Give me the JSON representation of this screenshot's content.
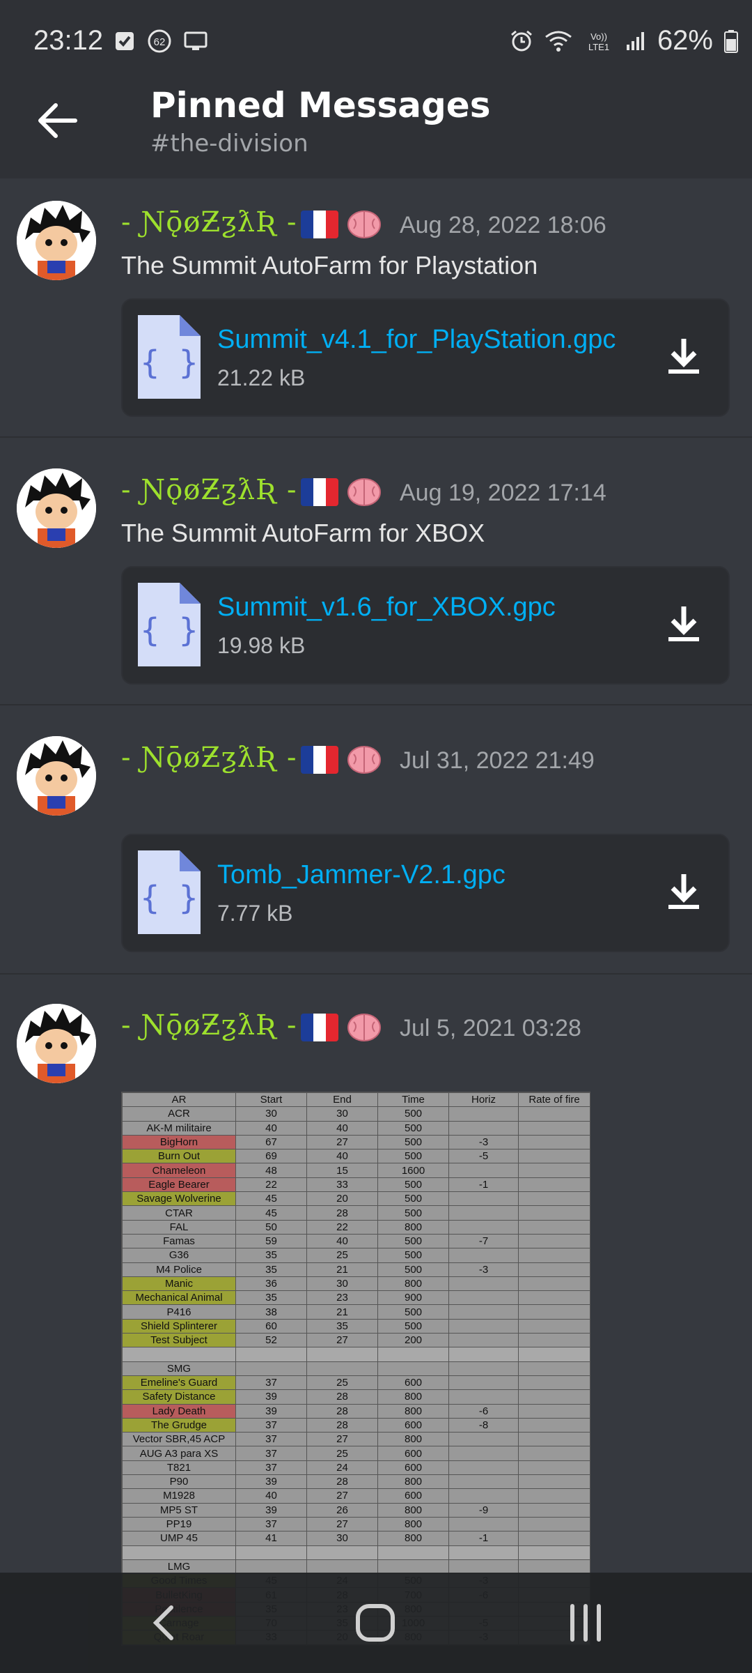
{
  "status_bar": {
    "time": "23:12",
    "battery": "62%",
    "notification_badge": "62",
    "icons": [
      "checkbox-icon",
      "notification-badge-icon",
      "cast-icon",
      "alarm-icon",
      "wifi-icon",
      "volte-icon",
      "signal-icon",
      "battery-icon"
    ]
  },
  "header": {
    "title": "Pinned Messages",
    "channel": "#the-division"
  },
  "messages": [
    {
      "author": "- ƝǭøƵƺƛƦ -",
      "date": "Aug 28, 2022 18:06",
      "text": "The Summit AutoFarm for Playstation",
      "file": {
        "name": "Summit_v4.1_for_PlayStation.gpc",
        "size": "21.22 kB"
      }
    },
    {
      "author": "- ƝǭøƵƺƛƦ -",
      "date": "Aug 19, 2022 17:14",
      "text": "The Summit AutoFarm for XBOX",
      "file": {
        "name": "Summit_v1.6_for_XBOX.gpc",
        "size": "19.98 kB"
      }
    },
    {
      "author": "- ƝǭøƵƺƛƦ -",
      "date": "Jul 31, 2022 21:49",
      "text": "",
      "file": {
        "name": "Tomb_Jammer-V2.1.gpc",
        "size": "7.77 kB"
      }
    },
    {
      "author": "- ƝǭøƵƺƛƦ -",
      "date": "Jul 5, 2021 03:28",
      "text": ""
    }
  ],
  "colors": {
    "background": "#36393f",
    "header": "#2f3136",
    "author": "#9ee12d",
    "link": "#00aff4"
  },
  "sheet": {
    "headers": [
      "AR",
      "Start",
      "End",
      "Time",
      "Horiz",
      "Rate of fire"
    ],
    "rows": [
      {
        "c": [
          "ACR",
          "30",
          "30",
          "500",
          "",
          ""
        ],
        "t": ""
      },
      {
        "c": [
          "AK-M militaire",
          "40",
          "40",
          "500",
          "",
          ""
        ],
        "t": ""
      },
      {
        "c": [
          "BigHorn",
          "67",
          "27",
          "500",
          "-3",
          ""
        ],
        "t": "red"
      },
      {
        "c": [
          "Burn Out",
          "69",
          "40",
          "500",
          "-5",
          ""
        ],
        "t": "ylw"
      },
      {
        "c": [
          "Chameleon",
          "48",
          "15",
          "1600",
          "",
          ""
        ],
        "t": "red"
      },
      {
        "c": [
          "Eagle Bearer",
          "22",
          "33",
          "500",
          "-1",
          ""
        ],
        "t": "red"
      },
      {
        "c": [
          "Savage Wolverine",
          "45",
          "20",
          "500",
          "",
          ""
        ],
        "t": "ylw"
      },
      {
        "c": [
          "CTAR",
          "45",
          "28",
          "500",
          "",
          ""
        ],
        "t": ""
      },
      {
        "c": [
          "FAL",
          "50",
          "22",
          "800",
          "",
          ""
        ],
        "t": ""
      },
      {
        "c": [
          "Famas",
          "59",
          "40",
          "500",
          "-7",
          ""
        ],
        "t": ""
      },
      {
        "c": [
          "G36",
          "35",
          "25",
          "500",
          "",
          ""
        ],
        "t": ""
      },
      {
        "c": [
          "M4 Police",
          "35",
          "21",
          "500",
          "-3",
          ""
        ],
        "t": ""
      },
      {
        "c": [
          "Manic",
          "36",
          "30",
          "800",
          "",
          ""
        ],
        "t": "ylw"
      },
      {
        "c": [
          "Mechanical Animal",
          "35",
          "23",
          "900",
          "",
          ""
        ],
        "t": "ylw"
      },
      {
        "c": [
          "P416",
          "38",
          "21",
          "500",
          "",
          ""
        ],
        "t": ""
      },
      {
        "c": [
          "Shield Splinterer",
          "60",
          "35",
          "500",
          "",
          ""
        ],
        "t": "ylw"
      },
      {
        "c": [
          "Test Subject",
          "52",
          "27",
          "200",
          "",
          ""
        ],
        "t": "ylw"
      },
      {
        "c": [
          "",
          "",
          "",
          "",
          "",
          ""
        ],
        "t": "sep"
      },
      {
        "c": [
          "SMG",
          "",
          "",
          "",
          "",
          ""
        ],
        "t": ""
      },
      {
        "c": [
          "Emeline's Guard",
          "37",
          "25",
          "600",
          "",
          ""
        ],
        "t": "ylw"
      },
      {
        "c": [
          "Safety Distance",
          "39",
          "28",
          "800",
          "",
          ""
        ],
        "t": "ylw"
      },
      {
        "c": [
          "Lady Death",
          "39",
          "28",
          "800",
          "-6",
          ""
        ],
        "t": "red"
      },
      {
        "c": [
          "The Grudge",
          "37",
          "28",
          "600",
          "-8",
          ""
        ],
        "t": "ylw"
      },
      {
        "c": [
          "Vector SBR,45 ACP",
          "37",
          "27",
          "800",
          "",
          ""
        ],
        "t": ""
      },
      {
        "c": [
          "AUG A3 para XS",
          "37",
          "25",
          "600",
          "",
          ""
        ],
        "t": ""
      },
      {
        "c": [
          "T821",
          "37",
          "24",
          "600",
          "",
          ""
        ],
        "t": ""
      },
      {
        "c": [
          "P90",
          "39",
          "28",
          "800",
          "",
          ""
        ],
        "t": ""
      },
      {
        "c": [
          "M1928",
          "40",
          "27",
          "600",
          "",
          ""
        ],
        "t": ""
      },
      {
        "c": [
          "MP5 ST",
          "39",
          "26",
          "800",
          "-9",
          ""
        ],
        "t": ""
      },
      {
        "c": [
          "PP19",
          "37",
          "27",
          "800",
          "",
          ""
        ],
        "t": ""
      },
      {
        "c": [
          "UMP 45",
          "41",
          "30",
          "800",
          "-1",
          ""
        ],
        "t": ""
      },
      {
        "c": [
          "",
          "",
          "",
          "",
          "",
          ""
        ],
        "t": "sep"
      },
      {
        "c": [
          "LMG",
          "",
          "",
          "",
          "",
          ""
        ],
        "t": ""
      },
      {
        "c": [
          "Good Times",
          "45",
          "24",
          "500",
          "-3",
          ""
        ],
        "t": "ylw"
      },
      {
        "c": [
          "BulletKing",
          "61",
          "28",
          "700",
          "-6",
          ""
        ],
        "t": "red"
      },
      {
        "c": [
          "Pestilence",
          "35",
          "23",
          "800",
          "",
          ""
        ],
        "t": "red"
      },
      {
        "c": [
          "Carnage",
          "70",
          "35",
          "1000",
          "-5",
          ""
        ],
        "t": "ylw"
      },
      {
        "c": [
          "Quiet Roar",
          "33",
          "20",
          "800",
          "-3",
          ""
        ],
        "t": "ylw"
      }
    ]
  }
}
